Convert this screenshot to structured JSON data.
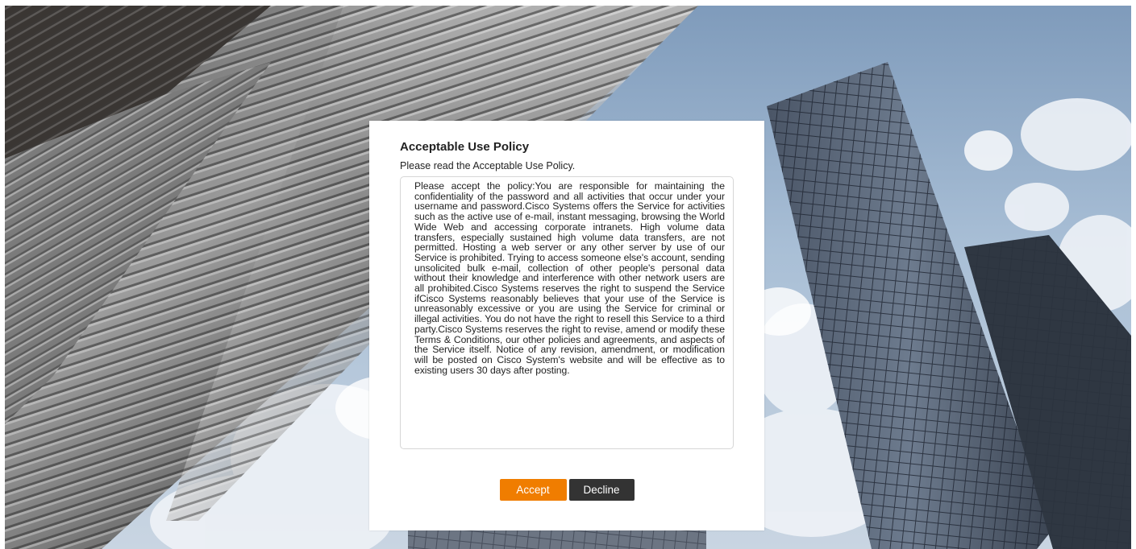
{
  "dialog": {
    "title": "Acceptable Use Policy",
    "subtitle": "Please read the Acceptable Use Policy.",
    "policy_text": "Please accept the policy:You are responsible for maintaining the confidentiality of the password and all activities that occur under your username and password.Cisco Systems offers the Service for activities such as the active use of e-mail, instant messaging, browsing the World Wide Web and accessing corporate intranets. High volume data transfers, especially sustained high volume data transfers, are not permitted. Hosting a web server or any other server by use of our Service is prohibited. Trying to access someone else's account, sending unsolicited bulk e-mail, collection of other people's personal data without their knowledge and interference with other network users are all prohibited.Cisco Systems reserves the right to suspend the Service ifCisco Systems reasonably believes that your use of the Service is unreasonably excessive or you are using the Service for criminal or illegal activities. You do not have the right to resell this Service to a third party.Cisco Systems reserves the right to revise, amend or modify these Terms & Conditions, our other policies and agreements, and aspects of the Service itself. Notice of any revision, amendment, or modification will be posted on Cisco System's website and will be effective as to existing users 30 days after posting.",
    "accept_label": "Accept",
    "decline_label": "Decline"
  },
  "colors": {
    "accept_button": "#f07d00",
    "decline_button": "#333333",
    "dialog_background": "#ffffff"
  }
}
